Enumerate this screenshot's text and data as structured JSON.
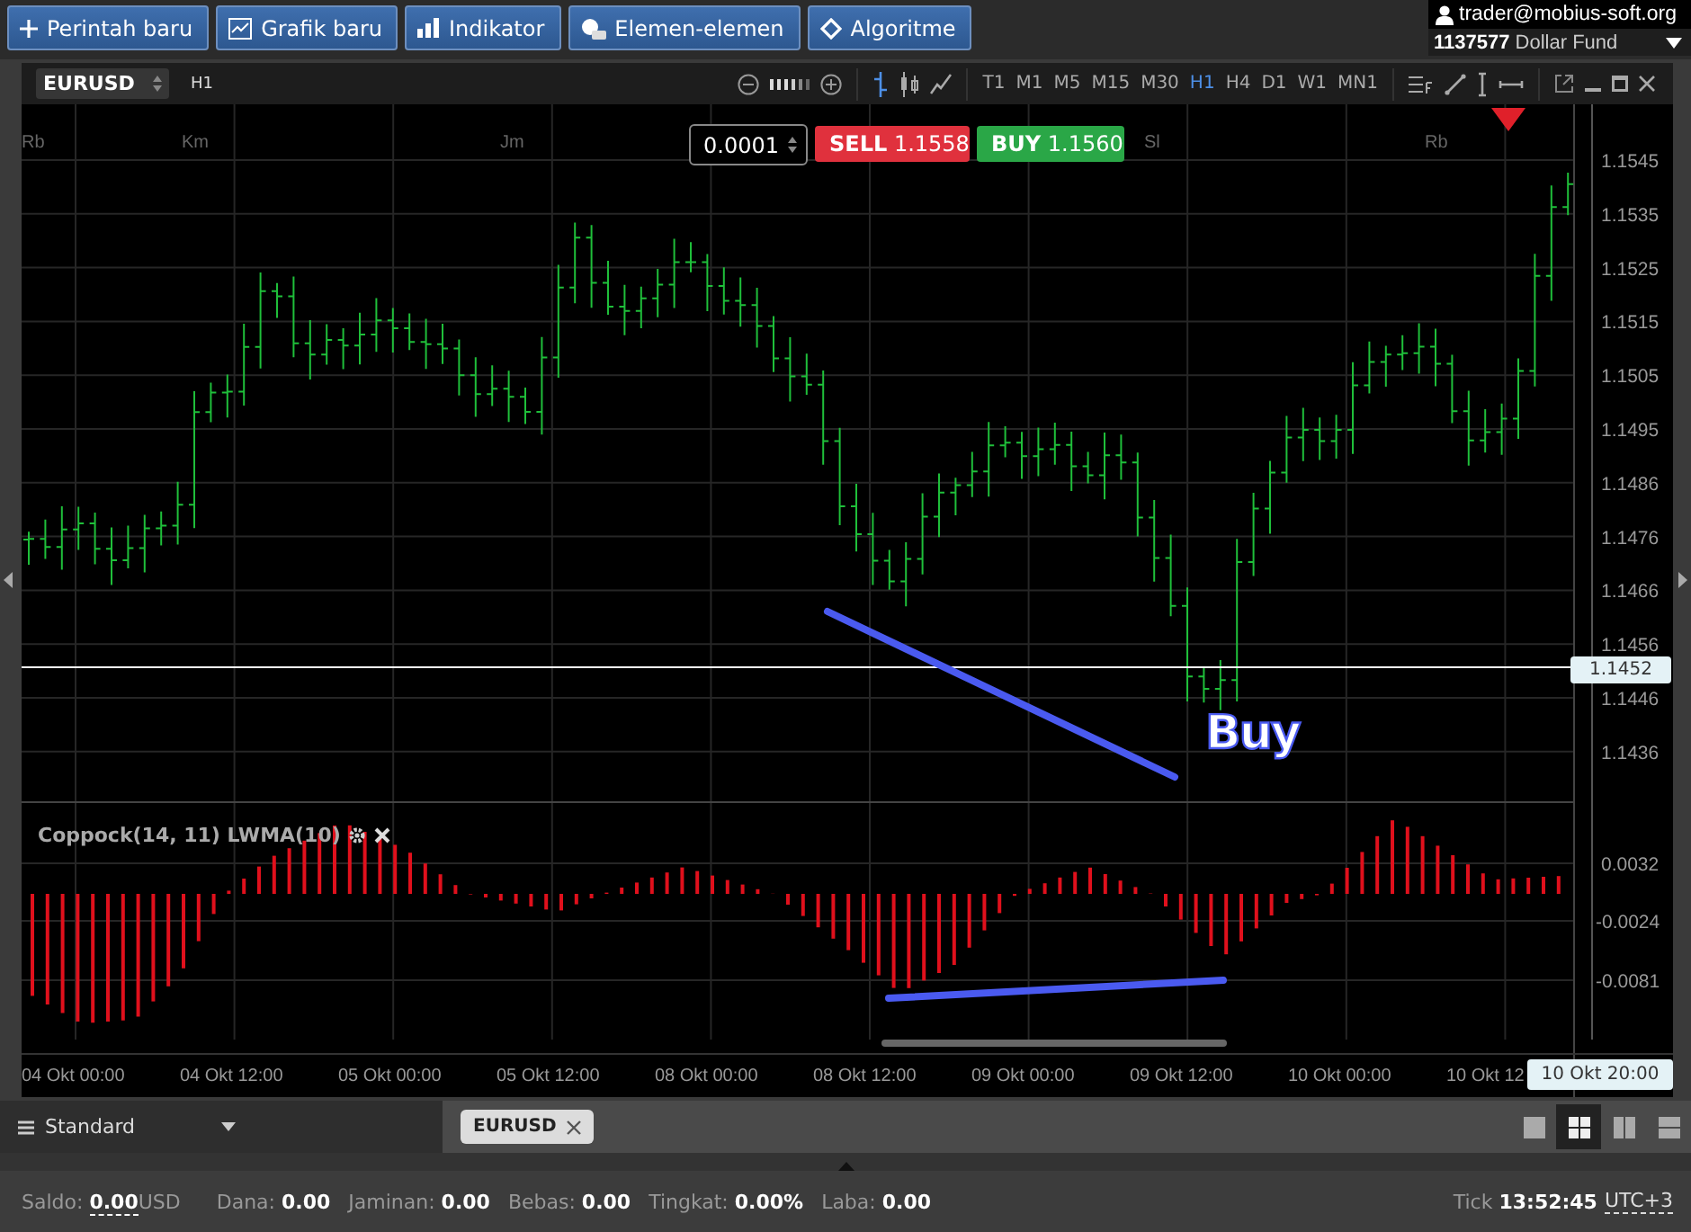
{
  "toolbar": {
    "buttons": [
      {
        "label": "Perintah baru",
        "kind": "plus"
      },
      {
        "label": "Grafik baru",
        "kind": "chart"
      },
      {
        "label": "Indikator",
        "kind": "bars"
      },
      {
        "label": "Elemen-elemen",
        "kind": "shapes"
      },
      {
        "label": "Algoritme",
        "kind": "diamond"
      }
    ]
  },
  "account": {
    "user": "trader@mobius-soft.org",
    "number": "1137577",
    "name": "Dollar Fund"
  },
  "chart": {
    "symbol": "EURUSD",
    "period": "H1",
    "chart_types": [
      {
        "kind": "bar",
        "selected": true
      },
      {
        "kind": "candle",
        "selected": false
      },
      {
        "kind": "line",
        "selected": false
      }
    ],
    "timeframes": [
      {
        "label": "T1",
        "selected": false
      },
      {
        "label": "M1",
        "selected": false
      },
      {
        "label": "M5",
        "selected": false
      },
      {
        "label": "M15",
        "selected": false
      },
      {
        "label": "M30",
        "selected": false
      },
      {
        "label": "H1",
        "selected": true
      },
      {
        "label": "H4",
        "selected": false
      },
      {
        "label": "D1",
        "selected": false
      },
      {
        "label": "W1",
        "selected": false
      },
      {
        "label": "MN1",
        "selected": false
      }
    ],
    "step": "0.0001",
    "sell": {
      "label": "SELL",
      "price": "1.1558"
    },
    "buy": {
      "label": "BUY",
      "price": "1.1560"
    },
    "session_labels": [
      "Rb",
      "Km",
      "Jm",
      "Sl",
      "Rb"
    ],
    "price_ticks": [
      "1.1545",
      "1.1535",
      "1.1525",
      "1.1515",
      "1.1505",
      "1.1495",
      "1.1486",
      "1.1476",
      "1.1466",
      "1.1456",
      "1.1446",
      "1.1436"
    ],
    "current_price": "1.1452",
    "annotation": "Buy",
    "indicator": {
      "title": "Coppock(14, 11) LWMA(10)",
      "ticks": [
        "0.0032",
        "-0.0024",
        "-0.0081"
      ]
    },
    "time_labels": [
      "04 Okt 00:00",
      "04 Okt 12:00",
      "05 Okt 00:00",
      "05 Okt 12:00",
      "08 Okt 00:00",
      "08 Okt 12:00",
      "09 Okt 00:00",
      "09 Okt 12:00",
      "10 Okt 00:00",
      "10 Okt 12"
    ],
    "crosshair_time": "10 Okt 20:00"
  },
  "workspace": {
    "layout": "Standard",
    "tabs": [
      {
        "label": "EURUSD"
      }
    ],
    "layouts": [
      {
        "kind": "single",
        "selected": false
      },
      {
        "kind": "grid",
        "selected": true
      },
      {
        "kind": "columns",
        "selected": false
      },
      {
        "kind": "rows",
        "selected": false
      }
    ]
  },
  "status_bar": {
    "items": [
      {
        "label": "Saldo:",
        "value": "0.00",
        "unit": "USD"
      },
      {
        "label": "Dana:",
        "value": "0.00"
      },
      {
        "label": "Jaminan:",
        "value": "0.00"
      },
      {
        "label": "Bebas:",
        "value": "0.00"
      },
      {
        "label": "Tingkat:",
        "value": "0.00%"
      },
      {
        "label": "Laba:",
        "value": "0.00"
      }
    ],
    "tick": {
      "label": "Tick",
      "time": "13:52:45",
      "zone": "UTC+3"
    }
  }
}
